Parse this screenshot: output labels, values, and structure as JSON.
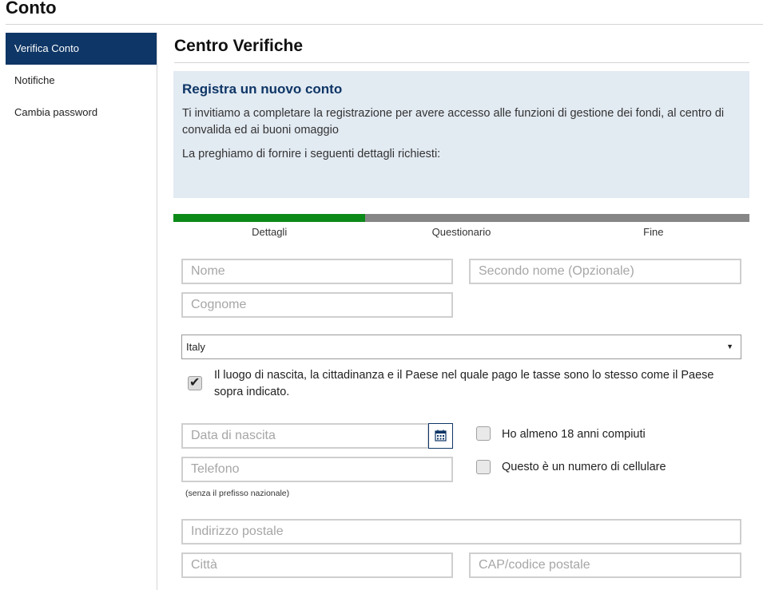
{
  "header": {
    "title": "Conto"
  },
  "sidebar": {
    "items": [
      {
        "label": "Verifica Conto"
      },
      {
        "label": "Notifiche"
      },
      {
        "label": "Cambia password"
      }
    ]
  },
  "main": {
    "title": "Centro Verifiche",
    "info": {
      "title": "Registra un nuovo conto",
      "text1": "Ti invitiamo a completare la registrazione per avere accesso alle funzioni di gestione dei fondi, al centro di convalida ed ai buoni omaggio",
      "text2": "La preghiamo di fornire i seguenti dettagli richiesti:"
    },
    "progress": {
      "completed_fraction": 0.333,
      "colors": {
        "done": "#0c8a18",
        "todo": "#868686"
      },
      "steps": [
        "Dettagli",
        "Questionario",
        "Fine"
      ]
    }
  },
  "form": {
    "first_name": {
      "placeholder": "Nome",
      "value": ""
    },
    "middle_name": {
      "placeholder": "Secondo nome (Opzionale)",
      "value": ""
    },
    "last_name": {
      "placeholder": "Cognome",
      "value": ""
    },
    "country": {
      "selected": "Italy"
    },
    "same_country": {
      "checked": true,
      "label": "Il luogo di nascita, la cittadinanza e il Paese nel quale pago le tasse sono lo stesso come il Paese sopra indicato."
    },
    "birthdate": {
      "placeholder": "Data di nascita",
      "value": "",
      "icon": "calendar-icon"
    },
    "adult": {
      "checked": false,
      "label": "Ho almeno 18 anni compiuti"
    },
    "phone": {
      "placeholder": "Telefono",
      "value": "",
      "hint": "(senza il prefisso nazionale)"
    },
    "mobile": {
      "checked": false,
      "label": "Questo è un numero di cellulare"
    },
    "address": {
      "placeholder": "Indirizzo postale",
      "value": ""
    },
    "city": {
      "placeholder": "Città",
      "value": ""
    },
    "postal_code": {
      "placeholder": "CAP/codice postale",
      "value": ""
    }
  },
  "colors": {
    "accent": "#0e3666",
    "info_bg": "#e2eaf2"
  }
}
